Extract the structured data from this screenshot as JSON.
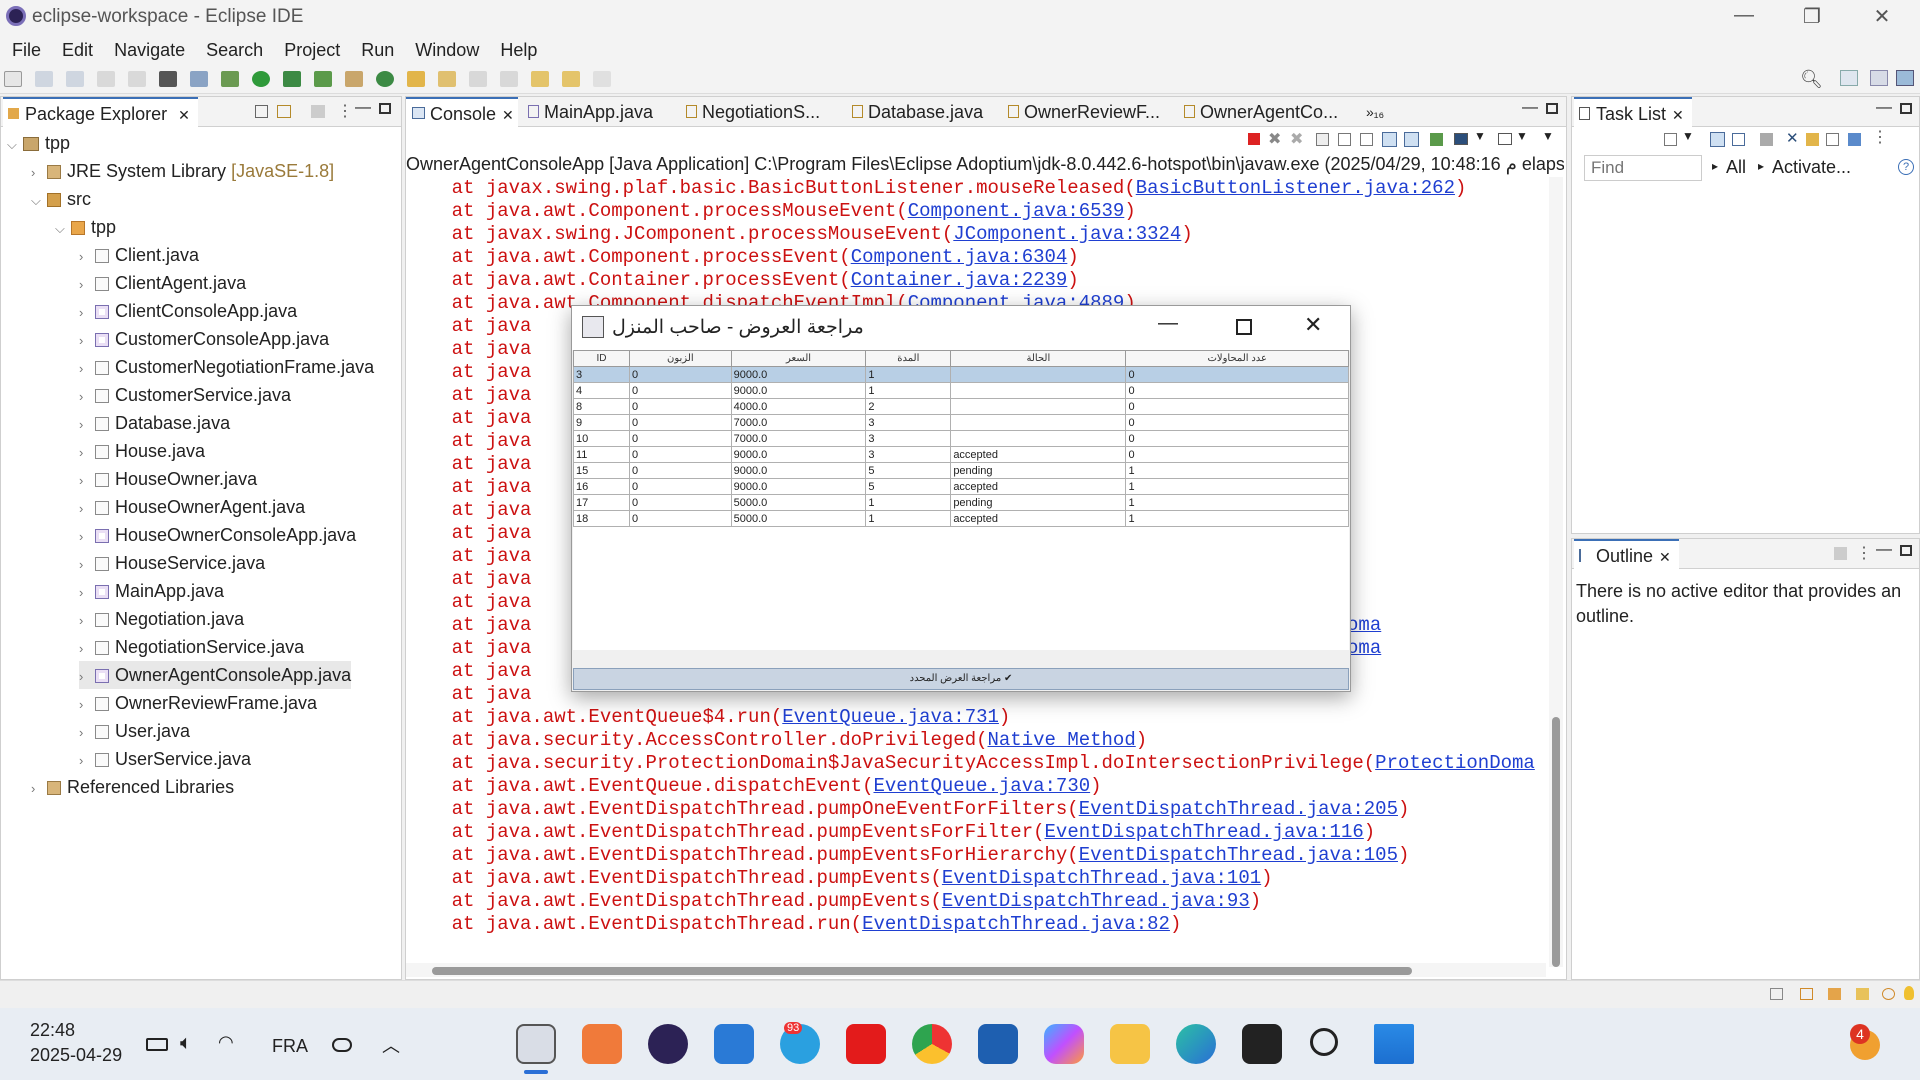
{
  "window": {
    "title": "eclipse-workspace - Eclipse IDE"
  },
  "menu": [
    "File",
    "Edit",
    "Navigate",
    "Search",
    "Project",
    "Run",
    "Window",
    "Help"
  ],
  "package_explorer": {
    "tab": "Package Explorer",
    "project": "tpp",
    "library": "JRE System Library",
    "library_suffix": "[JavaSE-1.8]",
    "src": "src",
    "package": "tpp",
    "files": [
      "Client.java",
      "ClientAgent.java",
      "ClientConsoleApp.java",
      "CustomerConsoleApp.java",
      "CustomerNegotiationFrame.java",
      "CustomerService.java",
      "Database.java",
      "House.java",
      "HouseOwner.java",
      "HouseOwnerAgent.java",
      "HouseOwnerConsoleApp.java",
      "HouseService.java",
      "MainApp.java",
      "Negotiation.java",
      "NegotiationService.java",
      "OwnerAgentConsoleApp.java",
      "OwnerReviewFrame.java",
      "User.java",
      "UserService.java"
    ],
    "selected": "OwnerAgentConsoleApp.java",
    "referenced": "Referenced Libraries"
  },
  "editor_tabs": [
    "Console",
    "MainApp.java",
    "NegotiationS...",
    "Database.java",
    "OwnerReviewF...",
    "OwnerAgentCo..."
  ],
  "editor_more": "»₁₆",
  "console": {
    "header": "OwnerAgentConsoleApp [Java Application] C:\\Program Files\\Eclipse Adoptium\\jdk-8.0.442.6-hotspot\\bin\\javaw.exe  (م 10:48:16 ,2025/04/29 elaps",
    "top_lines": [
      {
        "text": "    at javax.swing.plaf.basic.BasicButtonListener.mouseReleased(",
        "link": "BasicButtonListener.java:262",
        "end": ")"
      },
      {
        "text": "    at java.awt.Component.processMouseEvent(",
        "link": "Component.java:6539",
        "end": ")"
      },
      {
        "text": "    at javax.swing.JComponent.processMouseEvent(",
        "link": "JComponent.java:3324",
        "end": ")"
      },
      {
        "text": "    at java.awt.Component.processEvent(",
        "link": "Component.java:6304",
        "end": ")"
      },
      {
        "text": "    at java.awt.Container.processEvent(",
        "link": "Container.java:2239",
        "end": ")"
      },
      {
        "text": "    at java.awt.Component.dispatchEventImpl(",
        "link": "Component.java:4889",
        "end": ")"
      }
    ],
    "at_lines": [
      "    at java",
      "    at java",
      "    at java",
      "    at java",
      "    at java",
      "    at java",
      "    at java",
      "    at java",
      "    at java",
      "    at java",
      "    at java",
      "    at java",
      "    at java",
      "    at java",
      "    at java",
      "    at java",
      "    at java"
    ],
    "right_fragments": [
      {
        "text": "ege(",
        "link": "ProtectionDoma"
      },
      {
        "text": "ege(",
        "link": "ProtectionDoma"
      }
    ],
    "tail_lines": [
      {
        "text": "    at java.awt.EventQueue$4.run(",
        "link": "EventQueue.java:731",
        "end": ")"
      },
      {
        "text": "    at java.security.AccessController.doPrivileged(",
        "link": "Native Method",
        "end": ")"
      },
      {
        "text": "    at java.security.ProtectionDomain$JavaSecurityAccessImpl.doIntersectionPrivilege(",
        "link": "ProtectionDoma",
        "end": ""
      },
      {
        "text": "    at java.awt.EventQueue.dispatchEvent(",
        "link": "EventQueue.java:730",
        "end": ")"
      },
      {
        "text": "    at java.awt.EventDispatchThread.pumpOneEventForFilters(",
        "link": "EventDispatchThread.java:205",
        "end": ")"
      },
      {
        "text": "    at java.awt.EventDispatchThread.pumpEventsForFilter(",
        "link": "EventDispatchThread.java:116",
        "end": ")"
      },
      {
        "text": "    at java.awt.EventDispatchThread.pumpEventsForHierarchy(",
        "link": "EventDispatchThread.java:105",
        "end": ")"
      },
      {
        "text": "    at java.awt.EventDispatchThread.pumpEvents(",
        "link": "EventDispatchThread.java:101",
        "end": ")"
      },
      {
        "text": "    at java.awt.EventDispatchThread.pumpEvents(",
        "link": "EventDispatchThread.java:93",
        "end": ")"
      },
      {
        "text": "    at java.awt.EventDispatchThread.run(",
        "link": "EventDispatchThread.java:82",
        "end": ")"
      }
    ]
  },
  "dialog": {
    "title": "مراجعة العروض - صاحب المنزل",
    "columns": [
      "ID",
      "الزبون",
      "السعر",
      "المدة",
      "الحالة",
      "عدد المحاولات"
    ],
    "rows": [
      [
        "3",
        "0",
        "9000.0",
        "1",
        "",
        "0"
      ],
      [
        "4",
        "0",
        "9000.0",
        "1",
        "",
        "0"
      ],
      [
        "8",
        "0",
        "4000.0",
        "2",
        "",
        "0"
      ],
      [
        "9",
        "0",
        "7000.0",
        "3",
        "",
        "0"
      ],
      [
        "10",
        "0",
        "7000.0",
        "3",
        "",
        "0"
      ],
      [
        "11",
        "0",
        "9000.0",
        "3",
        "accepted",
        "0"
      ],
      [
        "15",
        "0",
        "9000.0",
        "5",
        "pending",
        "1"
      ],
      [
        "16",
        "0",
        "9000.0",
        "5",
        "accepted",
        "1"
      ],
      [
        "17",
        "0",
        "5000.0",
        "1",
        "pending",
        "1"
      ],
      [
        "18",
        "0",
        "5000.0",
        "1",
        "accepted",
        "1"
      ]
    ],
    "button": "مراجعة العرض المحدد ✔"
  },
  "task_list": {
    "tab": "Task List",
    "find_placeholder": "Find",
    "all": "All",
    "activate": "Activate..."
  },
  "outline": {
    "tab": "Outline",
    "message": "There is no active editor that provides an outline."
  },
  "taskbar": {
    "time": "22:48",
    "date": "2025-04-29",
    "lang": "FRA",
    "badge_telegram": "93",
    "badge_right": "4"
  },
  "colors": {
    "console_text": "#cc1111",
    "link": "#1f3fd1",
    "selection": "#b8cfe5"
  }
}
